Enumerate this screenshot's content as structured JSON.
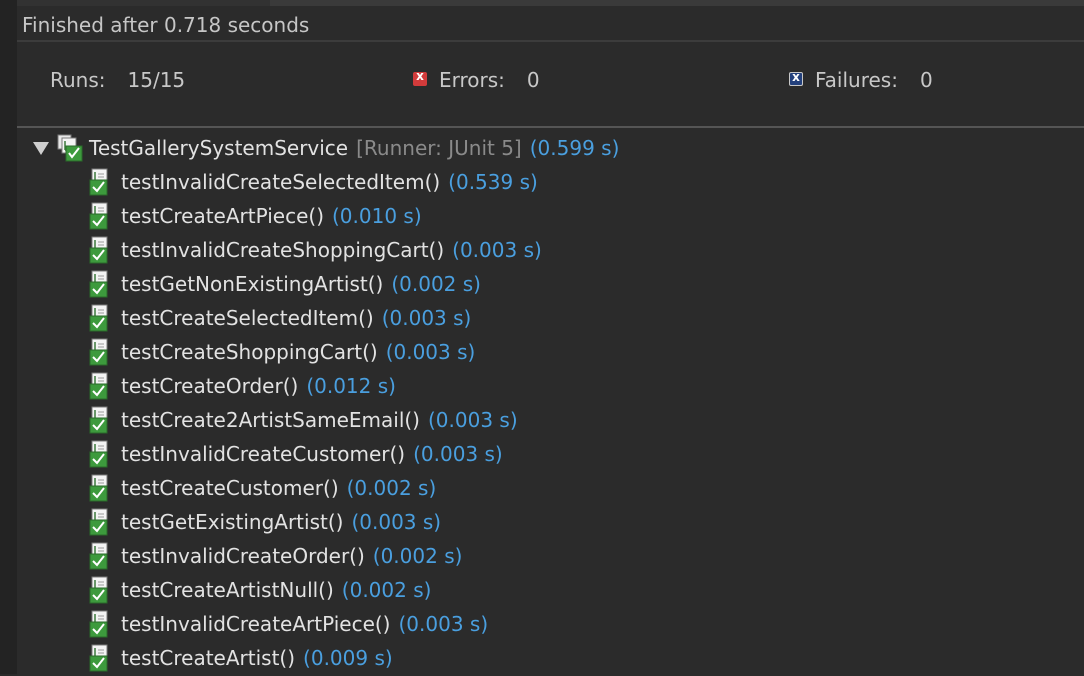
{
  "status": {
    "finished_text": "Finished after 0.718 seconds"
  },
  "counters": {
    "runs_label": "Runs:",
    "runs_value": "15/15",
    "errors_label": "Errors:",
    "errors_value": "0",
    "failures_label": "Failures:",
    "failures_value": "0",
    "errors_icon": "error-icon",
    "failures_icon": "failure-icon"
  },
  "colors": {
    "time": "#4a9fdf",
    "runner": "#8a8a8a",
    "name": "#e2e2e2",
    "background": "#2b2b2b"
  },
  "tree": {
    "suite": {
      "name": "TestGallerySystemService",
      "runner": "[Runner: JUnit 5]",
      "time": "(0.599 s)",
      "expanded": true,
      "icon": "test-suite-success-icon"
    },
    "tests": [
      {
        "name": "testInvalidCreateSelectedItem()",
        "time": "(0.539 s)",
        "icon": "test-success-icon"
      },
      {
        "name": "testCreateArtPiece()",
        "time": "(0.010 s)",
        "icon": "test-success-icon"
      },
      {
        "name": "testInvalidCreateShoppingCart()",
        "time": "(0.003 s)",
        "icon": "test-success-icon"
      },
      {
        "name": "testGetNonExistingArtist()",
        "time": "(0.002 s)",
        "icon": "test-success-icon"
      },
      {
        "name": "testCreateSelectedItem()",
        "time": "(0.003 s)",
        "icon": "test-success-icon"
      },
      {
        "name": "testCreateShoppingCart()",
        "time": "(0.003 s)",
        "icon": "test-success-icon"
      },
      {
        "name": "testCreateOrder()",
        "time": "(0.012 s)",
        "icon": "test-success-icon"
      },
      {
        "name": "testCreate2ArtistSameEmail()",
        "time": "(0.003 s)",
        "icon": "test-success-icon"
      },
      {
        "name": "testInvalidCreateCustomer()",
        "time": "(0.003 s)",
        "icon": "test-success-icon"
      },
      {
        "name": "testCreateCustomer()",
        "time": "(0.002 s)",
        "icon": "test-success-icon"
      },
      {
        "name": "testGetExistingArtist()",
        "time": "(0.003 s)",
        "icon": "test-success-icon"
      },
      {
        "name": "testInvalidCreateOrder()",
        "time": "(0.002 s)",
        "icon": "test-success-icon"
      },
      {
        "name": "testCreateArtistNull()",
        "time": "(0.002 s)",
        "icon": "test-success-icon"
      },
      {
        "name": "testInvalidCreateArtPiece()",
        "time": "(0.003 s)",
        "icon": "test-success-icon"
      },
      {
        "name": "testCreateArtist()",
        "time": "(0.009 s)",
        "icon": "test-success-icon"
      }
    ]
  }
}
